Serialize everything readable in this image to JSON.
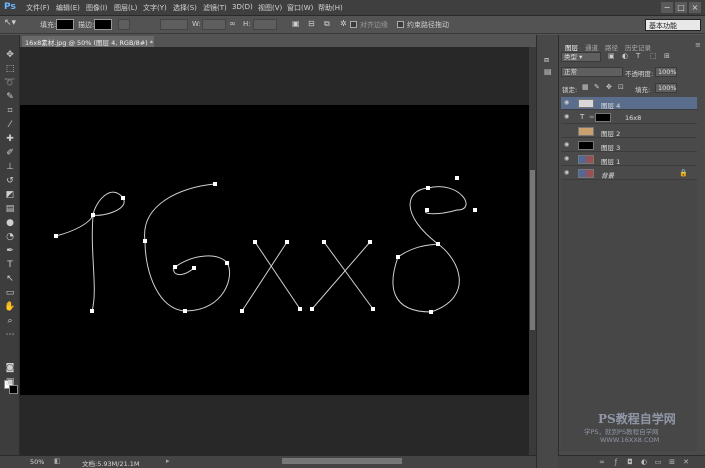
{
  "app": {
    "logo": "Ps"
  },
  "menu": [
    "文件(F)",
    "编辑(E)",
    "图像(I)",
    "图层(L)",
    "文字(Y)",
    "选择(S)",
    "滤镜(T)",
    "3D(D)",
    "视图(V)",
    "窗口(W)",
    "帮助(H)"
  ],
  "window_controls": [
    "−",
    "□",
    "×"
  ],
  "options_bar": {
    "fill_label": "填充:",
    "stroke_label": "描边:",
    "w_label": "W:",
    "h_label": "H:",
    "align_edges_label": "对齐边缘",
    "constrain_label": "约束路径拖动",
    "workspace": "基本功能"
  },
  "document": {
    "tab_title": "16x8素材.jpg @ 50% (图层 4, RGB/8#) *  ×",
    "canvas_text": "16xx8"
  },
  "status": {
    "zoom": "50%",
    "doc_info": "文档:5.93M/21.1M"
  },
  "panel": {
    "tabs": [
      "图层",
      "通道",
      "路径",
      "历史记录"
    ],
    "filter_kind": "类型",
    "blend_mode": "正常",
    "opacity_label": "不透明度:",
    "opacity_value": "100%",
    "lock_label": "锁定:",
    "fill_label": "填充:",
    "fill_value": "100%",
    "layers": [
      {
        "name": "图层 4",
        "selected": true,
        "visible": true,
        "thumb": "#d8d8d8"
      },
      {
        "name": "16x8",
        "type": "text",
        "visible": true,
        "thumb": "#000000"
      },
      {
        "name": "图层 2",
        "visible": false,
        "thumb": "#c9a070"
      },
      {
        "name": "图层 3",
        "visible": true,
        "thumb": "#000000"
      },
      {
        "name": "图层 1",
        "visible": true,
        "thumb": "#3a6fb0"
      },
      {
        "name": "背景",
        "visible": true,
        "thumb": "#3a6fb0",
        "locked": true
      }
    ]
  },
  "watermark": {
    "title": "PS教程自学网",
    "subtitle": "学PS，就到PS教程自学网",
    "url": "WWW.16XX8.COM"
  },
  "colors": {
    "accent": "#5a6d8c",
    "canvas": "#000000",
    "path": "#d0d0d0"
  }
}
